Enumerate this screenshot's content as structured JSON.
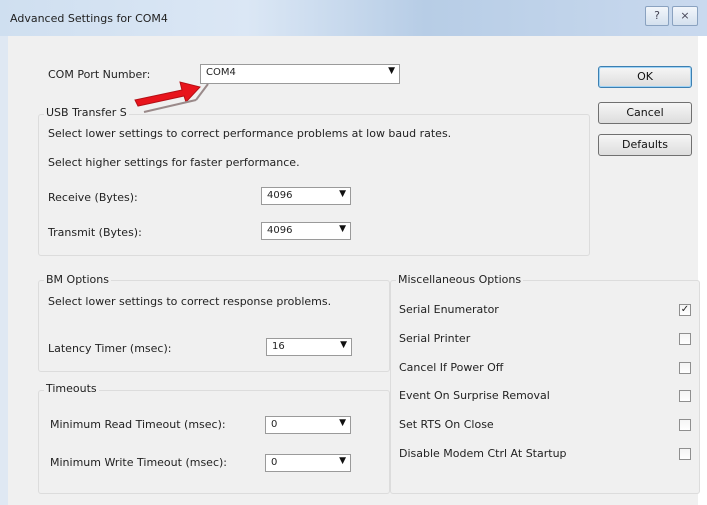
{
  "window": {
    "title": "Advanced Settings for COM4",
    "help_label": "?",
    "close_label": "×"
  },
  "com_port": {
    "label": "COM Port Number:",
    "value": "COM4"
  },
  "usb_transfer": {
    "legend": "USB Transfer S",
    "note_lower": "Select lower settings to correct performance problems at low baud rates.",
    "note_higher": "Select higher settings for faster performance.",
    "receive_label": "Receive (Bytes):",
    "receive_value": "4096",
    "transmit_label": "Transmit (Bytes):",
    "transmit_value": "4096"
  },
  "bm_options": {
    "legend": "BM Options",
    "note": "Select lower settings to correct response problems.",
    "latency_label": "Latency Timer (msec):",
    "latency_value": "16"
  },
  "timeouts": {
    "legend": "Timeouts",
    "read_label": "Minimum Read Timeout (msec):",
    "read_value": "0",
    "write_label": "Minimum Write Timeout (msec):",
    "write_value": "0"
  },
  "misc": {
    "legend": "Miscellaneous Options",
    "options": [
      {
        "label": "Serial Enumerator",
        "checked": true
      },
      {
        "label": "Serial Printer",
        "checked": false
      },
      {
        "label": "Cancel If Power Off",
        "checked": false
      },
      {
        "label": "Event On Surprise Removal",
        "checked": false
      },
      {
        "label": "Set RTS On Close",
        "checked": false
      },
      {
        "label": "Disable Modem Ctrl At Startup",
        "checked": false
      }
    ]
  },
  "buttons": {
    "ok": "OK",
    "cancel": "Cancel",
    "defaults": "Defaults"
  },
  "colors": {
    "annotation_arrow": "#e8141c"
  }
}
